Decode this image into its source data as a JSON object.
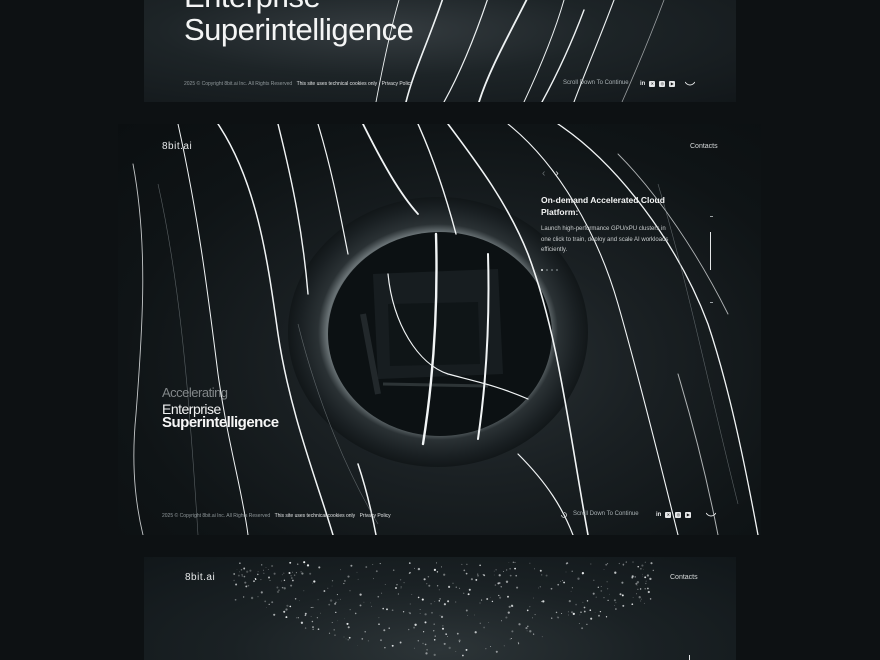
{
  "frames": [
    {
      "hero_line1": "Enterprise",
      "hero_line2": "Superintelligence",
      "footer": {
        "copyright": "2025 © Copyright 8bit.ai Inc. All Rights Reserved",
        "cookies": "This site uses technical cookies only",
        "privacy": "Privacy Policy"
      },
      "scroll_label": "Scroll Down To Continue",
      "socials": [
        "linkedin-icon",
        "x-icon",
        "instagram-icon",
        "youtube-icon"
      ]
    },
    {
      "logo": "8bit.ai",
      "nav_contacts": "Contacts",
      "hero_line0": "Accelerating",
      "hero_line1": "Enterprise",
      "hero_line2": "Superintelligence",
      "card": {
        "title": "On-demand Accelerated Cloud Platform:",
        "body": "Launch high-performance GPU/xPU clusters in one click to train, deploy and scale AI workloads efficiently."
      },
      "slider": {
        "total": 4,
        "active": 1
      },
      "footer": {
        "copyright": "2025 © Copyright 8bit.ai Inc. All Rights Reserved",
        "cookies": "This site uses technical cookies only",
        "privacy": "Privacy Policy"
      },
      "scroll_label": "Scroll Down To Continue",
      "socials": [
        "linkedin-icon",
        "x-icon",
        "instagram-icon",
        "youtube-icon"
      ]
    },
    {
      "logo": "8bit.ai",
      "nav_contacts": "Contacts"
    }
  ],
  "colors": {
    "background": "#0d1113",
    "text": "#e8eaeb",
    "muted": "#8f979a"
  }
}
